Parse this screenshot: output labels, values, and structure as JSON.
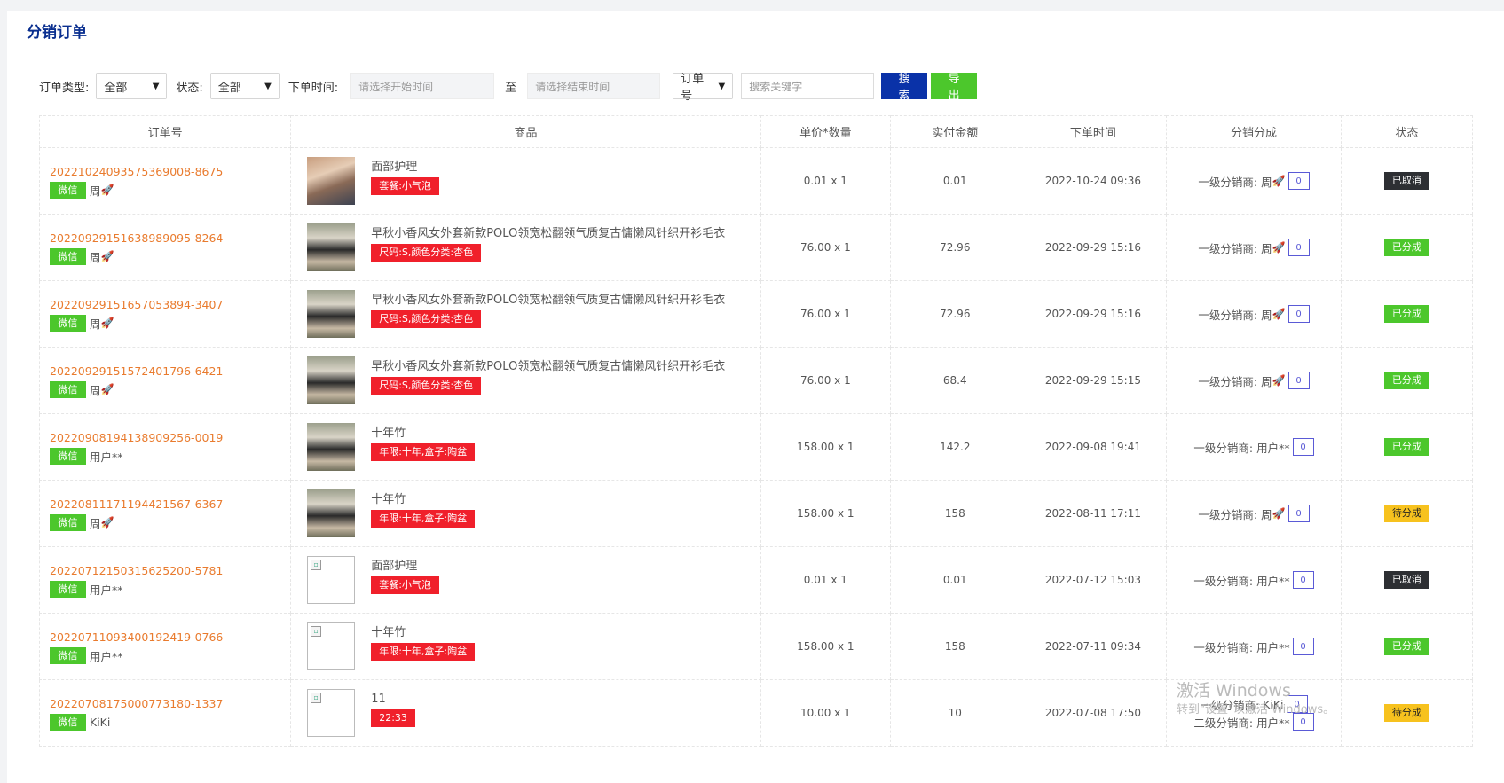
{
  "page": {
    "title": "分销订单"
  },
  "filters": {
    "order_type_label": "订单类型:",
    "order_type_value": "全部",
    "status_label": "状态:",
    "status_value": "全部",
    "time_label": "下单时间:",
    "start_placeholder": "请选择开始时间",
    "to_label": "至",
    "end_placeholder": "请选择结束时间",
    "field_value": "订单号",
    "keyword_placeholder": "搜索关键字",
    "search_label": "搜索",
    "export_label": "导出"
  },
  "table": {
    "headers": [
      "订单号",
      "商品",
      "单价*数量",
      "实付金额",
      "下单时间",
      "分销分成",
      "状态"
    ],
    "rows": [
      {
        "order_no": "20221024093575369008-8675",
        "channel": "微信",
        "buyer": "周",
        "rocket": true,
        "image": "photo-a",
        "goods": "面部护理",
        "spec": "套餐:小气泡",
        "price_qty": "0.01 x 1",
        "paid": "0.01",
        "time": "2022-10-24 09:36",
        "dist": [
          {
            "label": "一级分销商:",
            "name": "周",
            "rocket": true,
            "count": "0"
          }
        ],
        "status": "已取消",
        "status_type": "cancel"
      },
      {
        "order_no": "20220929151638989095-8264",
        "channel": "微信",
        "buyer": "周",
        "rocket": true,
        "image": "photo-b",
        "goods": "早秋小香风女外套新款POLO领宽松翻领气质复古慵懒风针织开衫毛衣",
        "spec": "尺码:S,颜色分类:杏色",
        "price_qty": "76.00 x 1",
        "paid": "72.96",
        "time": "2022-09-29 15:16",
        "dist": [
          {
            "label": "一级分销商:",
            "name": "周",
            "rocket": true,
            "count": "0"
          }
        ],
        "status": "已分成",
        "status_type": "done"
      },
      {
        "order_no": "20220929151657053894-3407",
        "channel": "微信",
        "buyer": "周",
        "rocket": true,
        "image": "photo-b",
        "goods": "早秋小香风女外套新款POLO领宽松翻领气质复古慵懒风针织开衫毛衣",
        "spec": "尺码:S,颜色分类:杏色",
        "price_qty": "76.00 x 1",
        "paid": "72.96",
        "time": "2022-09-29 15:16",
        "dist": [
          {
            "label": "一级分销商:",
            "name": "周",
            "rocket": true,
            "count": "0"
          }
        ],
        "status": "已分成",
        "status_type": "done"
      },
      {
        "order_no": "20220929151572401796-6421",
        "channel": "微信",
        "buyer": "周",
        "rocket": true,
        "image": "photo-b",
        "goods": "早秋小香风女外套新款POLO领宽松翻领气质复古慵懒风针织开衫毛衣",
        "spec": "尺码:S,颜色分类:杏色",
        "price_qty": "76.00 x 1",
        "paid": "68.4",
        "time": "2022-09-29 15:15",
        "dist": [
          {
            "label": "一级分销商:",
            "name": "周",
            "rocket": true,
            "count": "0"
          }
        ],
        "status": "已分成",
        "status_type": "done"
      },
      {
        "order_no": "20220908194138909256-0019",
        "channel": "微信",
        "buyer": "用户**",
        "rocket": false,
        "image": "photo-b",
        "goods": "十年竹",
        "spec": "年限:十年,盒子:陶盆",
        "price_qty": "158.00 x 1",
        "paid": "142.2",
        "time": "2022-09-08 19:41",
        "dist": [
          {
            "label": "一级分销商:",
            "name": "用户**",
            "rocket": false,
            "count": "0"
          }
        ],
        "status": "已分成",
        "status_type": "done"
      },
      {
        "order_no": "20220811171194421567-6367",
        "channel": "微信",
        "buyer": "周",
        "rocket": true,
        "image": "photo-b",
        "goods": "十年竹",
        "spec": "年限:十年,盒子:陶盆",
        "price_qty": "158.00 x 1",
        "paid": "158",
        "time": "2022-08-11 17:11",
        "dist": [
          {
            "label": "一级分销商:",
            "name": "周",
            "rocket": true,
            "count": "0"
          }
        ],
        "status": "待分成",
        "status_type": "pending"
      },
      {
        "order_no": "20220712150315625200-5781",
        "channel": "微信",
        "buyer": "用户**",
        "rocket": false,
        "image": "broken",
        "goods": "面部护理",
        "spec": "套餐:小气泡",
        "price_qty": "0.01 x 1",
        "paid": "0.01",
        "time": "2022-07-12 15:03",
        "dist": [
          {
            "label": "一级分销商:",
            "name": "用户**",
            "rocket": false,
            "count": "0"
          }
        ],
        "status": "已取消",
        "status_type": "cancel"
      },
      {
        "order_no": "20220711093400192419-0766",
        "channel": "微信",
        "buyer": "用户**",
        "rocket": false,
        "image": "broken",
        "goods": "十年竹",
        "spec": "年限:十年,盒子:陶盆",
        "price_qty": "158.00 x 1",
        "paid": "158",
        "time": "2022-07-11 09:34",
        "dist": [
          {
            "label": "一级分销商:",
            "name": "用户**",
            "rocket": false,
            "count": "0"
          }
        ],
        "status": "已分成",
        "status_type": "done"
      },
      {
        "order_no": "20220708175000773180-1337",
        "channel": "微信",
        "buyer": "KiKi",
        "rocket": false,
        "image": "broken",
        "goods": "11",
        "spec": "22:33",
        "price_qty": "10.00 x 1",
        "paid": "10",
        "time": "2022-07-08 17:50",
        "dist": [
          {
            "label": "一级分销商:",
            "name": "KiKi",
            "rocket": false,
            "count": "0"
          },
          {
            "label": "二级分销商:",
            "name": "用户**",
            "rocket": false,
            "count": "0"
          }
        ],
        "status": "待分成",
        "status_type": "pending"
      }
    ]
  },
  "watermark": {
    "line1": "激活 Windows",
    "line2": "转到\"设置\"以激活 Windows。"
  },
  "icons": {
    "rocket": "rocket-icon",
    "chevron": "chevron-down-icon"
  },
  "colors": {
    "brand": "#0a32a8",
    "order_no": "#e97b2e",
    "wechat": "#4cc72c",
    "spec_tag": "#f0202b",
    "cancel": "#2d2f33",
    "pending": "#f7c21e"
  }
}
